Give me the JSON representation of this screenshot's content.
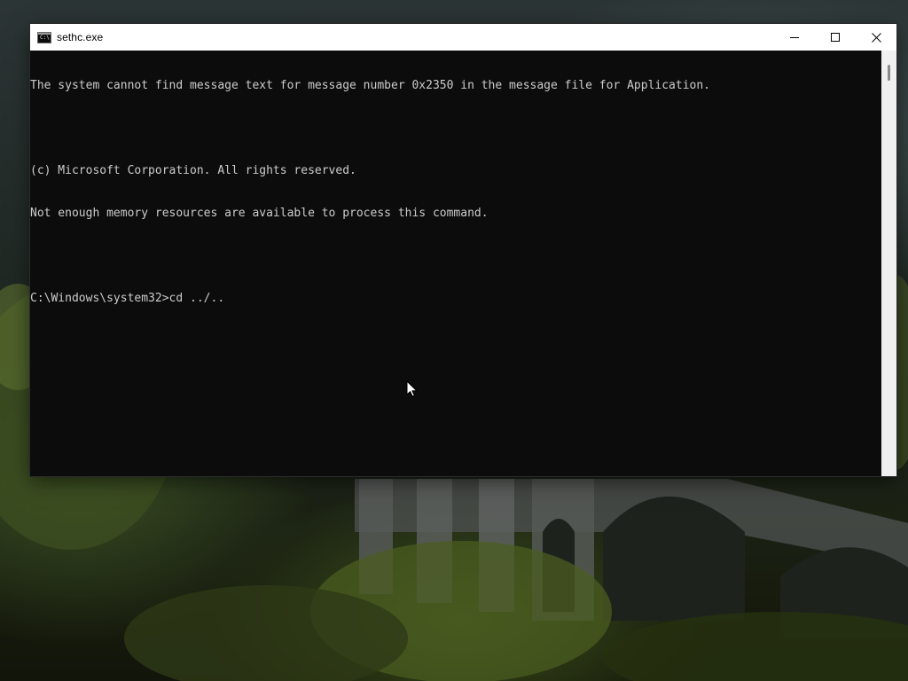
{
  "window": {
    "title": "sethc.exe",
    "icon": "console-icon",
    "icon_glyph": "C:\\",
    "controls": {
      "minimize": "minimize-icon",
      "maximize": "maximize-icon",
      "close": "close-icon"
    }
  },
  "console": {
    "lines": [
      "The system cannot find message text for message number 0x2350 in the message file for Application.",
      "",
      "(c) Microsoft Corporation. All rights reserved.",
      "Not enough memory resources are available to process this command.",
      "",
      "C:\\Windows\\system32>cd ../.."
    ],
    "text_color": "#cccccc",
    "background": "#0c0c0c"
  },
  "cursor": {
    "icon": "mouse-pointer-icon"
  }
}
